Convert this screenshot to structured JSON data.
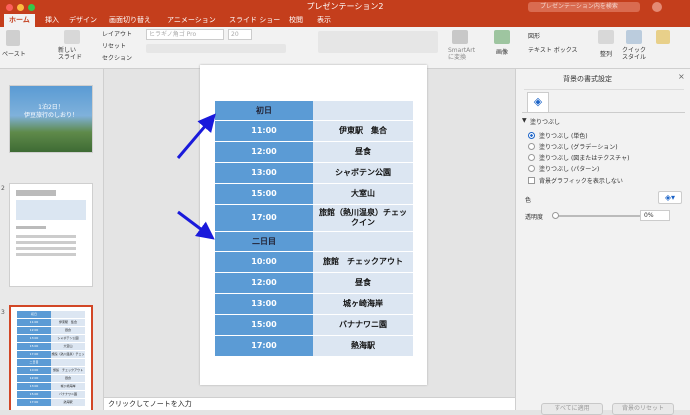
{
  "window": {
    "title": "プレゼンテーション2",
    "search_placeholder": "プレゼンテーション内を検索"
  },
  "tabs": [
    "ホーム",
    "挿入",
    "デザイン",
    "画面切り替え",
    "アニメーション",
    "スライド ショー",
    "校閲",
    "表示"
  ],
  "ribbon": {
    "paste": "ペースト",
    "new_slide": "新しい\nスライド",
    "layout": "レイアウト",
    "reset": "リセット",
    "section": "セクション",
    "font_name": "ヒラギノ角ゴ Pro",
    "font_size": "20",
    "smartart": "SmartArt\nに変換",
    "image": "画像",
    "shapes": "図形",
    "textbox": "テキスト ボックス",
    "arrange": "整列",
    "quick_style": "クイック\nスタイル"
  },
  "thumbs": [
    {
      "num": "",
      "title": "1泊2日！\n伊豆旅行のしおり！"
    },
    {
      "num": "2"
    },
    {
      "num": "3"
    }
  ],
  "schedule": {
    "day1": "初日",
    "day1_rows": [
      [
        "11:00",
        "伊東駅　集合"
      ],
      [
        "12:00",
        "昼食"
      ],
      [
        "13:00",
        "シャボテン公園"
      ],
      [
        "15:00",
        "大室山"
      ],
      [
        "17:00",
        "旅館（熱川温泉）チェックイン"
      ]
    ],
    "day2": "二日目",
    "day2_rows": [
      [
        "10:00",
        "旅館　チェックアウト"
      ],
      [
        "12:00",
        "昼食"
      ],
      [
        "13:00",
        "城ヶ崎海岸"
      ],
      [
        "15:00",
        "バナナワニ園"
      ],
      [
        "17:00",
        "熱海駅"
      ]
    ]
  },
  "notes_placeholder": "クリックしてノートを入力",
  "panel": {
    "title": "背景の書式設定",
    "section": "塗りつぶし",
    "options": [
      "塗りつぶし (単色)",
      "塗りつぶし (グラデーション)",
      "塗りつぶし (図またはテクスチャ)",
      "塗りつぶし (パターン)"
    ],
    "checkbox": "背景グラフィックを表示しない",
    "color_label": "色",
    "transparency_label": "透明度",
    "transparency_value": "0%",
    "apply_all": "すべてに適用",
    "reset_bg": "背景のリセット"
  },
  "colors": {
    "accent": "#c43e1c",
    "table_time": "#5b9bd5",
    "table_desc": "#dce6f2",
    "arrow": "#1a1adb"
  }
}
